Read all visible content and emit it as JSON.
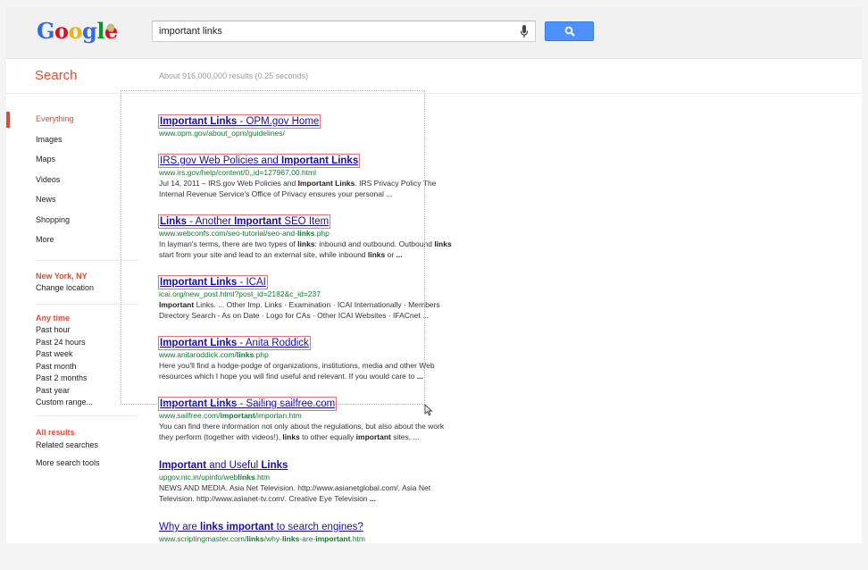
{
  "header": {
    "logo_letters": [
      {
        "ch": "G",
        "color": "#3369e8"
      },
      {
        "ch": "o",
        "color": "#d50f25"
      },
      {
        "ch": "o",
        "color": "#eeb211"
      },
      {
        "ch": "g",
        "color": "#3369e8"
      },
      {
        "ch": "l",
        "color": "#009925"
      },
      {
        "ch": "e",
        "color": "#d50f25"
      }
    ],
    "search_value": "important links"
  },
  "search_title": "Search",
  "result_stats": "About 916,000,000 results (0.25 seconds)",
  "nav": {
    "types": [
      "Everything",
      "Images",
      "Maps",
      "Videos",
      "News",
      "Shopping",
      "More"
    ],
    "location_head": "New York, NY",
    "location_change": "Change location",
    "time_head": "Any time",
    "times": [
      "Past hour",
      "Past 24 hours",
      "Past week",
      "Past month",
      "Past 2 months",
      "Past year",
      "Custom range..."
    ],
    "results_head": "All results",
    "related": "Related searches",
    "more_tools": "More search tools"
  },
  "results": [
    {
      "title_parts": [
        {
          "t": "Important Links",
          "b": true
        },
        {
          "t": " - OPM.gov Home",
          "b": false
        }
      ],
      "url_parts": [
        {
          "t": "www.opm.gov/about_opm/guidelines/",
          "b": false
        }
      ],
      "snippet": [],
      "boxed": true
    },
    {
      "title_parts": [
        {
          "t": "IRS.gov Web Policies and ",
          "b": false
        },
        {
          "t": "Important Links",
          "b": true
        }
      ],
      "url_parts": [
        {
          "t": "www.irs.gov/help/content/0,,id=127967,00.html",
          "b": false
        }
      ],
      "snippet": [
        [
          {
            "t": "Jul 14, 2011 – IRS.gov Web Policies and ",
            "b": false
          },
          {
            "t": "Important Links",
            "b": true
          },
          {
            "t": ". IRS Privacy Policy The",
            "b": false
          }
        ],
        [
          {
            "t": "Internal Revenue Service's Office of Privacy ensures your personal ...",
            "b": false
          }
        ]
      ],
      "boxed": true
    },
    {
      "title_parts": [
        {
          "t": "Links",
          "b": true
        },
        {
          "t": " - Another ",
          "b": false
        },
        {
          "t": "Important",
          "b": true
        },
        {
          "t": " SEO Item",
          "b": false
        }
      ],
      "url_parts": [
        {
          "t": "www.webconfs.com/seo-tutorial/seo-and-",
          "b": false
        },
        {
          "t": "links",
          "b": true
        },
        {
          "t": ".php",
          "b": false
        }
      ],
      "snippet": [
        [
          {
            "t": "In layman's terms, there are two types of ",
            "b": false
          },
          {
            "t": "links",
            "b": true
          },
          {
            "t": ": inbound and outbound. Outbound ",
            "b": false
          },
          {
            "t": "links",
            "b": true
          }
        ],
        [
          {
            "t": "start from your site and lead to an external site, while inbound ",
            "b": false
          },
          {
            "t": "links",
            "b": true
          },
          {
            "t": " or ",
            "b": false
          },
          {
            "t": "...",
            "b": true
          }
        ]
      ],
      "boxed": true
    },
    {
      "title_parts": [
        {
          "t": "Important Links",
          "b": true
        },
        {
          "t": " - ICAI",
          "b": false
        }
      ],
      "url_parts": [
        {
          "t": "icai.org/new_post.html?post_id=2182&c_id=237",
          "b": false
        }
      ],
      "snippet": [
        [
          {
            "t": "Important",
            "b": true
          },
          {
            "t": " Links. ... Other Imp. Links · Examination · ICAI Internationally · Members",
            "b": false
          }
        ],
        [
          {
            "t": "Directory Search - As on Date · Logo for CAs · Other ICAI Websites · IFACnet ...",
            "b": false
          }
        ]
      ],
      "boxed": true
    },
    {
      "title_parts": [
        {
          "t": "Important Links",
          "b": true
        },
        {
          "t": " - Anita Roddick",
          "b": false
        }
      ],
      "url_parts": [
        {
          "t": "www.anitaroddick.com/",
          "b": false
        },
        {
          "t": "links",
          "b": true
        },
        {
          "t": ".php",
          "b": false
        }
      ],
      "snippet": [
        [
          {
            "t": "Here you'll find a hodge-podge of organizations, institutions, media and other Web",
            "b": false
          }
        ],
        [
          {
            "t": "resources which I hope you will find useful and relevant. If you would care to ",
            "b": false
          },
          {
            "t": "...",
            "b": true
          }
        ]
      ],
      "boxed": true
    },
    {
      "title_parts": [
        {
          "t": "Important Links",
          "b": true
        },
        {
          "t": " - Sailing sailfree.com",
          "b": false
        }
      ],
      "url_parts": [
        {
          "t": "www.sailfree.com/",
          "b": false
        },
        {
          "t": "important",
          "b": true
        },
        {
          "t": "/importan.htm",
          "b": false
        }
      ],
      "snippet": [
        [
          {
            "t": "You can find there information not only about the regulations, but also about the work",
            "b": false
          }
        ],
        [
          {
            "t": "they perform (together with videos!), ",
            "b": false
          },
          {
            "t": "links",
            "b": true
          },
          {
            "t": " to other equally ",
            "b": false
          },
          {
            "t": "important",
            "b": true
          },
          {
            "t": " sites, ...",
            "b": false
          }
        ]
      ],
      "boxed": true
    },
    {
      "title_parts": [
        {
          "t": "Important",
          "b": true
        },
        {
          "t": " and Useful ",
          "b": false
        },
        {
          "t": "Links",
          "b": true
        }
      ],
      "url_parts": [
        {
          "t": "upgov.nic.in/upinfo/web",
          "b": false
        },
        {
          "t": "links",
          "b": true
        },
        {
          "t": ".htm",
          "b": false
        }
      ],
      "snippet": [
        [
          {
            "t": "NEWS AND MEDIA. Asia Net Television. http://www.asianetglobal.com/. Asia Net",
            "b": false
          }
        ],
        [
          {
            "t": "Television. http://www.asianet-tv.com/. Creative Eye Television ",
            "b": false
          },
          {
            "t": "...",
            "b": true
          }
        ]
      ],
      "boxed": false
    },
    {
      "title_parts": [
        {
          "t": "Why are ",
          "b": false
        },
        {
          "t": "links important",
          "b": true
        },
        {
          "t": " to search engines?",
          "b": false
        }
      ],
      "url_parts": [
        {
          "t": "www.scriptingmaster.com/",
          "b": false
        },
        {
          "t": "links",
          "b": true
        },
        {
          "t": "/why-",
          "b": false
        },
        {
          "t": "links",
          "b": true
        },
        {
          "t": "-are-",
          "b": false
        },
        {
          "t": "important",
          "b": true
        },
        {
          "t": ".htm",
          "b": false
        }
      ],
      "snippet": [],
      "boxed": false
    }
  ],
  "colors": {
    "accent_red": "#dd4b39",
    "link_blue": "#1a0dab",
    "url_green": "#0a7c2e",
    "button_blue": "#4d90fe",
    "selection_outline": "#f0a064",
    "title_box": "#e8737d"
  }
}
